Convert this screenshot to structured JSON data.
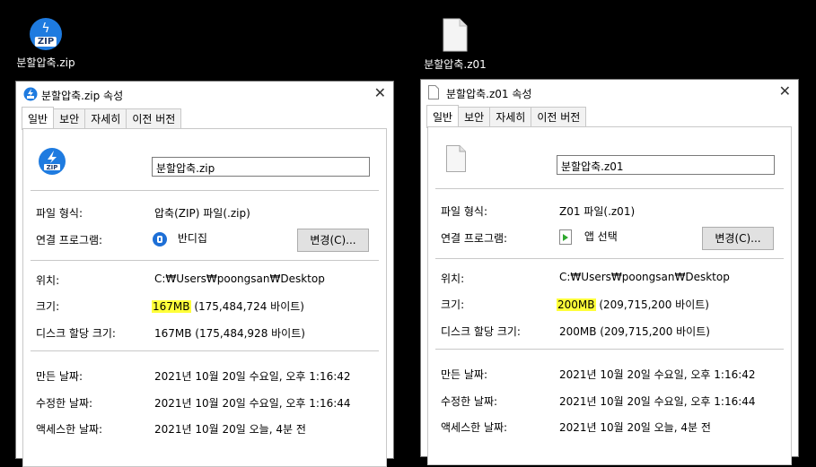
{
  "desktop": {
    "zip_icon_label": "분할압축.zip",
    "z01_icon_label": "분할압축.z01",
    "zip_badge_text": "ZIP"
  },
  "dialog_zip": {
    "title": "분할압축.zip 속성",
    "tabs": [
      "일반",
      "보안",
      "자세히",
      "이전 버전"
    ],
    "file_name": "분할압축.zip",
    "file_type_label": "파일 형식:",
    "file_type_value": "압축(ZIP) 파일(.zip)",
    "opens_with_label": "연결 프로그램:",
    "opens_with_value": "반디집",
    "change_button": "변경(C)...",
    "location_label": "위치:",
    "location_value": "C:₩Users₩poongsan₩Desktop",
    "size_label": "크기:",
    "size_highlight": "167MB",
    "size_detail": " (175,484,724 바이트)",
    "disk_size_label": "디스크 할당 크기:",
    "disk_size_value": "167MB (175,484,928 바이트)",
    "created_label": "만든 날짜:",
    "created_value": "2021년 10월 20일 수요일, 오후 1:16:42",
    "modified_label": "수정한 날짜:",
    "modified_value": "2021년 10월 20일 수요일, 오후 1:16:44",
    "accessed_label": "액세스한 날짜:",
    "accessed_value": "2021년 10월 20일 오늘, 4분 전",
    "badge_text": "ZIP"
  },
  "dialog_z01": {
    "title": "분할압축.z01 속성",
    "tabs": [
      "일반",
      "보안",
      "자세히",
      "이전 버전"
    ],
    "file_name": "분할압축.z01",
    "file_type_label": "파일 형식:",
    "file_type_value": "Z01 파일(.z01)",
    "opens_with_label": "연결 프로그램:",
    "opens_with_value": "앱 선택",
    "change_button": "변경(C)...",
    "location_label": "위치:",
    "location_value": "C:₩Users₩poongsan₩Desktop",
    "size_label": "크기:",
    "size_highlight": "200MB",
    "size_detail": " (209,715,200 바이트)",
    "disk_size_label": "디스크 할당 크기:",
    "disk_size_value": "200MB (209,715,200 바이트)",
    "created_label": "만든 날짜:",
    "created_value": "2021년 10월 20일 수요일, 오후 1:16:42",
    "modified_label": "수정한 날짜:",
    "modified_value": "2021년 10월 20일 수요일, 오후 1:16:44",
    "accessed_label": "액세스한 날짜:",
    "accessed_value": "2021년 10월 20일 오늘, 4분 전"
  },
  "colors": {
    "highlight": "#ffff3a",
    "zip_blue": "#1e7be0",
    "desktop_bg": "#000000"
  }
}
